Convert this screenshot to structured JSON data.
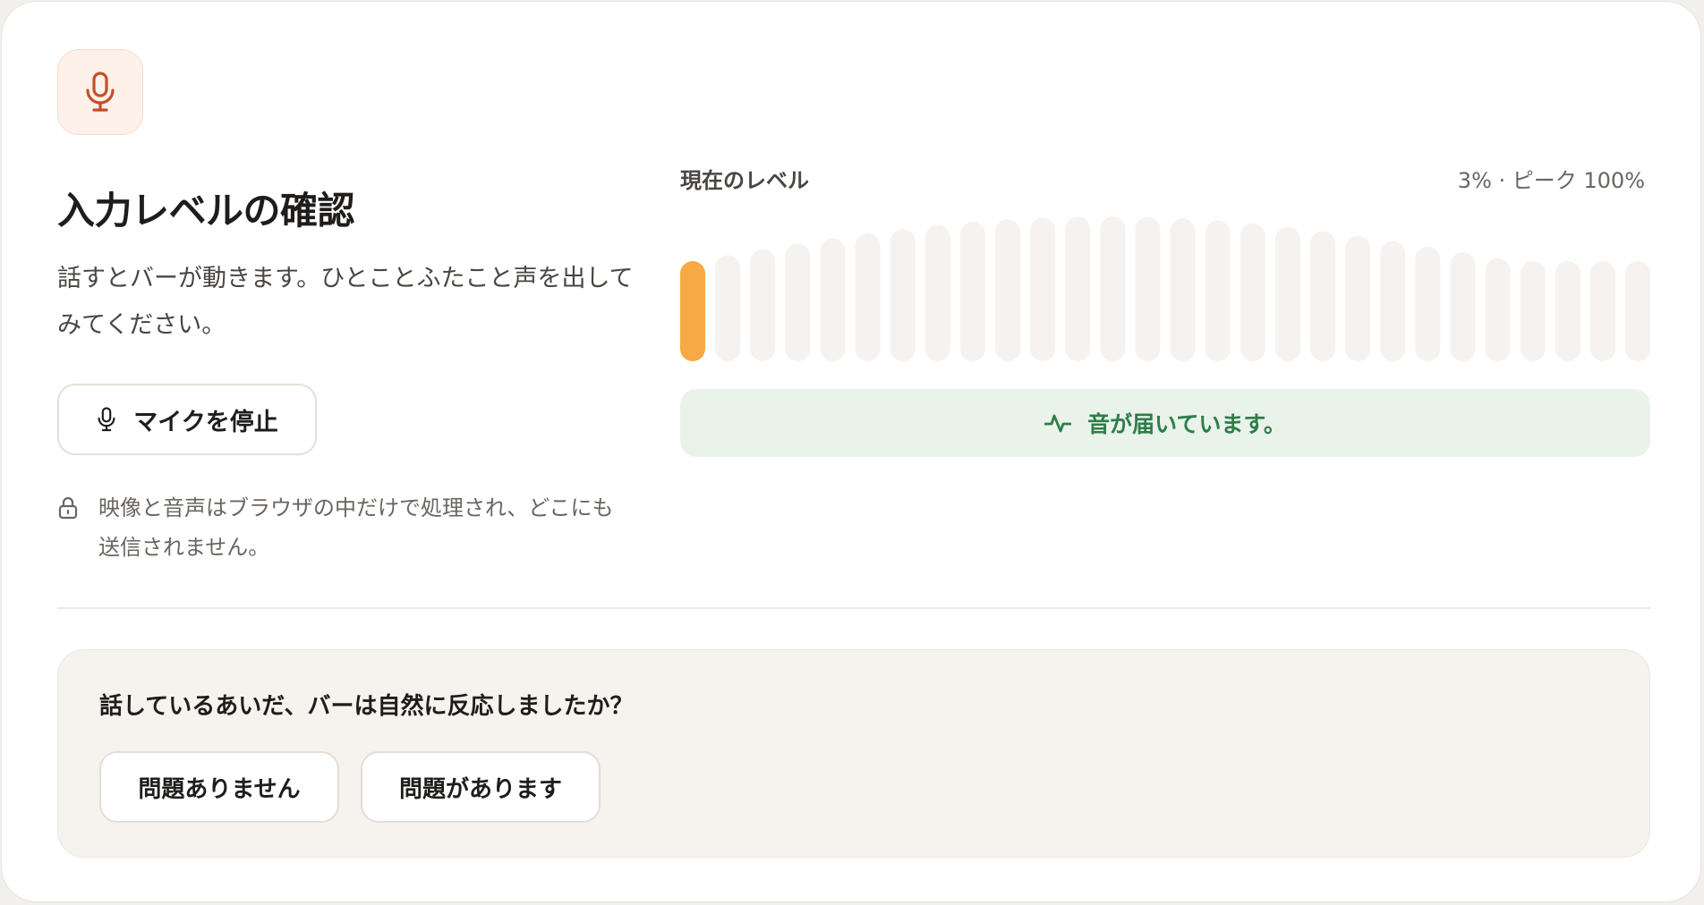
{
  "header": {
    "title": "入力レベルの確認",
    "description": "話すとバーが動きます。ひとことふたこと声を出してみてください。"
  },
  "controls": {
    "stop_mic_label": "マイクを停止"
  },
  "privacy": {
    "note": "映像と音声はブラウザの中だけで処理され、どこにも送信されません。"
  },
  "meter": {
    "label": "現在のレベル",
    "readout": "3% · ピーク 100%",
    "current_level": 0.03,
    "peak_level": 1.0,
    "bar_count": 28,
    "active_bars": 1,
    "colors": {
      "active": "#f6a944",
      "inactive": "#f6f2ef"
    }
  },
  "status": {
    "text": "音が届いています。",
    "icon": "activity-icon",
    "color": "#2f7d4a"
  },
  "feedback": {
    "question": "話しているあいだ、バーは自然に反応しましたか？",
    "ok_label": "問題ありません",
    "ng_label": "問題があります"
  },
  "icons": {
    "mic": "microphone-icon",
    "lock": "lock-icon"
  },
  "colors": {
    "accent": "#c2502a",
    "badge_bg": "#fdf1ea"
  }
}
